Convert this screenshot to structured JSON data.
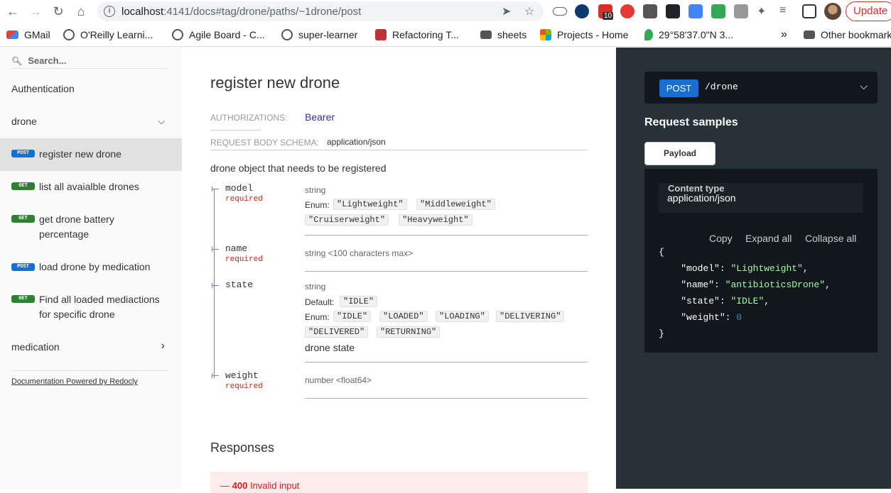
{
  "browser": {
    "url_host": "localhost",
    "url_rest": ":4141/docs#tag/drone/paths/~1drone/post",
    "update_label": "Update",
    "ext_badge": "10",
    "bookmarks": [
      {
        "label": "GMail"
      },
      {
        "label": "O'Reilly Learni..."
      },
      {
        "label": "Agile Board - C..."
      },
      {
        "label": "super-learner"
      },
      {
        "label": "Refactoring T..."
      },
      {
        "label": "sheets"
      },
      {
        "label": "Projects - Home"
      },
      {
        "label": "29°58'37.0\"N 3..."
      },
      {
        "label": "Other bookmarks"
      }
    ]
  },
  "sidebar": {
    "search_placeholder": "Search...",
    "sections": [
      {
        "label": "Authentication"
      },
      {
        "label": "drone"
      },
      {
        "label": "medication"
      }
    ],
    "operations": [
      {
        "method": "POST",
        "label": "register new drone"
      },
      {
        "method": "GET",
        "label": "list all avaialble drones"
      },
      {
        "method": "GET",
        "label": "get drone battery percentage"
      },
      {
        "method": "POST",
        "label": "load drone by medication"
      },
      {
        "method": "GET",
        "label": "Find all loaded mediactions for specific drone"
      }
    ],
    "powered_by": "Documentation Powered by Redocly"
  },
  "main": {
    "title": "register new drone",
    "auth_label": "AUTHORIZATIONS:",
    "auth_value": "Bearer",
    "schema_label": "REQUEST BODY SCHEMA:",
    "schema_value": "application/json",
    "description": "drone object that needs to be registered",
    "props": {
      "model": {
        "name": "model",
        "required": "required",
        "type": "string",
        "enum_label": "Enum:",
        "enum": [
          "\"Lightweight\"",
          "\"Middleweight\"",
          "\"Cruiserweight\"",
          "\"Heavyweight\""
        ]
      },
      "name": {
        "name": "name",
        "required": "required",
        "type": "string <100 characters max>"
      },
      "state": {
        "name": "state",
        "type": "string",
        "default_label": "Default:",
        "default": "\"IDLE\"",
        "enum_label": "Enum:",
        "enum": [
          "\"IDLE\"",
          "\"LOADED\"",
          "\"LOADING\"",
          "\"DELIVERING\"",
          "\"DELIVERED\"",
          "\"RETURNING\""
        ],
        "description": "drone state"
      },
      "weight": {
        "name": "weight",
        "required": "required",
        "type": "number <float64>"
      }
    },
    "responses_title": "Responses",
    "response_400": {
      "code": "400",
      "text": "Invalid input",
      "prefix": "—"
    }
  },
  "right": {
    "method": "POST",
    "path": "/drone",
    "samples_title": "Request samples",
    "payload_tab": "Payload",
    "content_type_label": "Content type",
    "content_type_value": "application/json",
    "copy": "Copy",
    "expand_all": "Expand all",
    "collapse_all": "Collapse all",
    "sample": {
      "open": "{",
      "close": "}",
      "model_key": "\"model\"",
      "model_val": "\"Lightweight\"",
      "name_key": "\"name\"",
      "name_val": "\"antibioticsDrone\"",
      "state_key": "\"state\"",
      "state_val": "\"IDLE\"",
      "weight_key": "\"weight\"",
      "weight_val": "0"
    }
  },
  "colors": {
    "post": "#186fcf",
    "get": "#2f8132",
    "required": "#d41f1c",
    "right_bg": "#263238"
  }
}
